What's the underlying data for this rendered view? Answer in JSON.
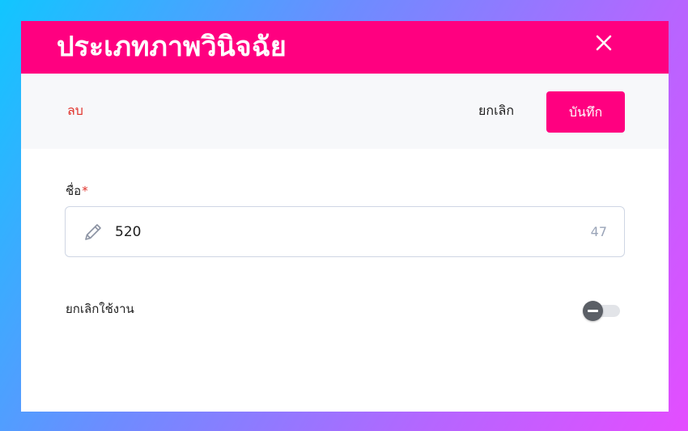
{
  "dialog": {
    "title": "ประเภทภาพวินิจฉัย",
    "close_icon": "close-icon"
  },
  "toolbar": {
    "delete_label": "ลบ",
    "cancel_label": "ยกเลิก",
    "save_label": "บันทึก"
  },
  "form": {
    "name_field": {
      "label": "ชื่อ",
      "required_mark": "*",
      "value": "520",
      "remaining_chars": "47",
      "icon": "pencil-icon"
    },
    "disable_toggle": {
      "label": "ยกเลิกใช้งาน",
      "checked": false
    }
  },
  "colors": {
    "brand": "#ff0080",
    "danger": "#e0312a",
    "toolbar_bg": "#f7f8fa"
  }
}
